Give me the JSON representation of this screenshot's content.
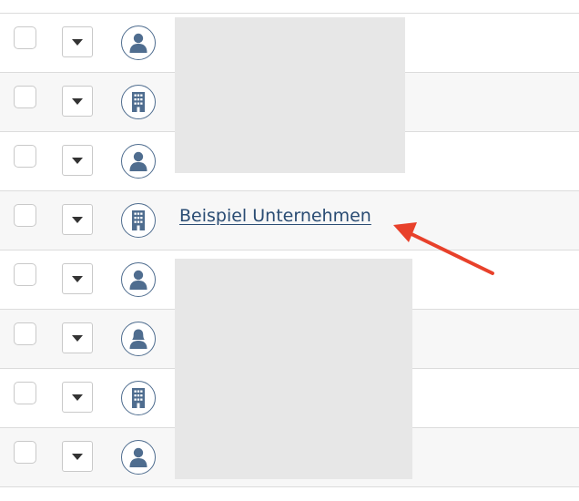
{
  "rows": [
    {
      "type": "person"
    },
    {
      "type": "company"
    },
    {
      "type": "person"
    },
    {
      "type": "company",
      "name": "Beispiel Unternehmen"
    },
    {
      "type": "person"
    },
    {
      "type": "female-person"
    },
    {
      "type": "company"
    },
    {
      "type": "person"
    }
  ],
  "icons": {
    "dropdown": "caret-down-icon",
    "person": "person-icon",
    "female-person": "person-female-icon",
    "company": "building-icon",
    "annotation": "red-arrow-icon"
  },
  "colors": {
    "icon": "#4f6d8f",
    "link": "#2a4c73",
    "annotation_arrow": "#e8412b",
    "row_alt_background": "#f7f7f7",
    "redaction": "#e7e7e7"
  }
}
